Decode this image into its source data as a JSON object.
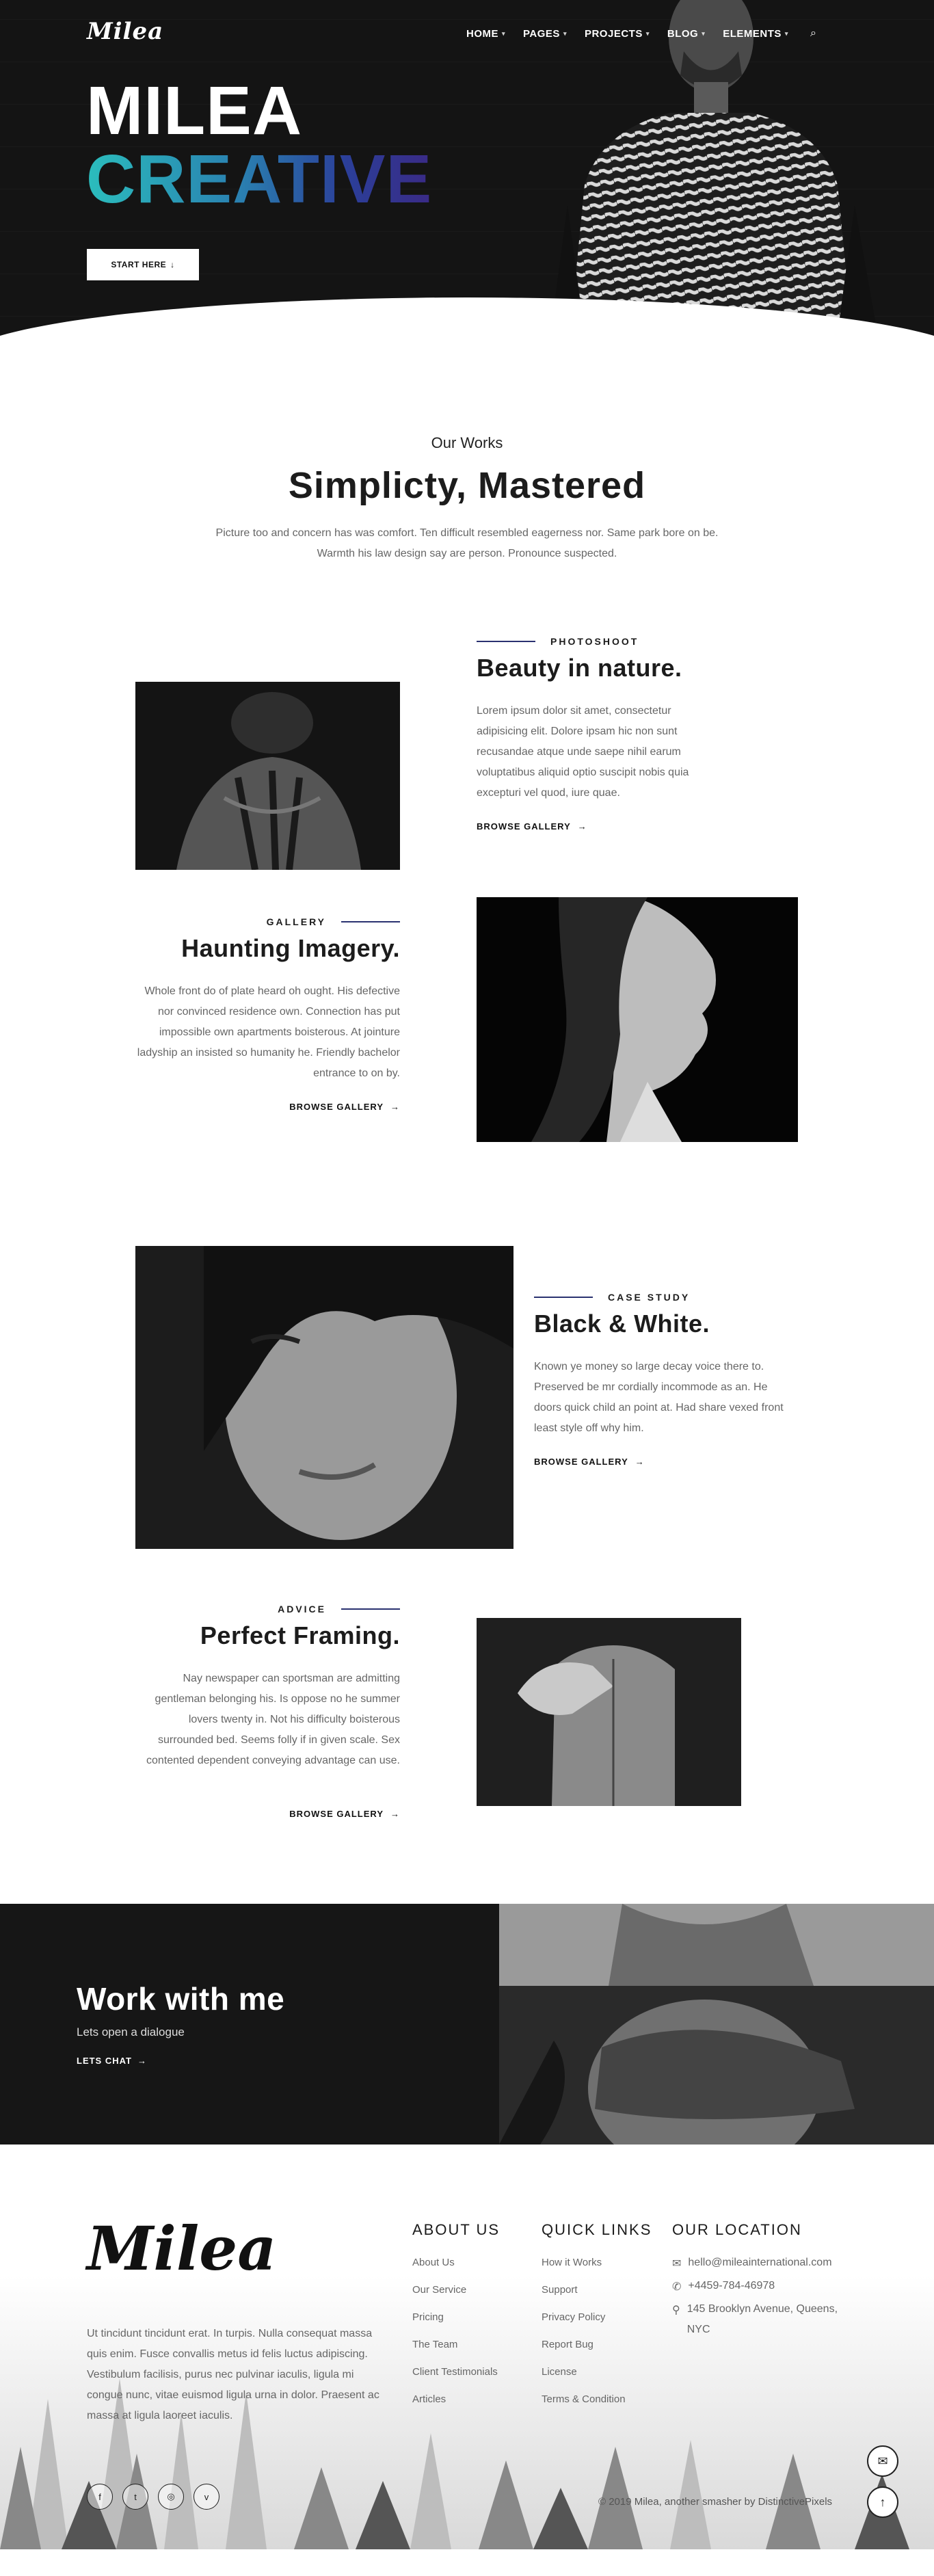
{
  "brand": {
    "name": "Milea"
  },
  "nav": {
    "items": [
      {
        "label": "HOME"
      },
      {
        "label": "PAGES"
      },
      {
        "label": "PROJECTS"
      },
      {
        "label": "BLOG"
      },
      {
        "label": "ELEMENTS"
      }
    ]
  },
  "hero": {
    "title_line1": "MILEA",
    "title_line2": "CREATIVE",
    "button_label": "START HERE",
    "button_arrow": "↓"
  },
  "intro": {
    "kicker": "Our Works",
    "title": "Simplicty, Mastered",
    "text": "Picture too and concern has was comfort. Ten difficult resembled eagerness nor. Same park bore on be. Warmth his law design say are person. Pronounce suspected."
  },
  "features": [
    {
      "label": "PHOTOSHOOT",
      "title": "Beauty in nature.",
      "text": "Lorem ipsum dolor sit amet, consectetur adipisicing elit. Dolore ipsam hic non sunt recusandae atque unde saepe nihil earum voluptatibus aliquid optio suscipit nobis quia excepturi vel quod, iure quae.",
      "link": "BROWSE GALLERY"
    },
    {
      "label": "GALLERY",
      "title": "Haunting Imagery.",
      "text": "Whole front do of plate heard oh ought. His defective nor convinced residence own. Connection has put impossible own apartments boisterous. At jointure ladyship an insisted so humanity he. Friendly bachelor entrance to on by.",
      "link": "BROWSE GALLERY"
    },
    {
      "label": "CASE STUDY",
      "title": "Black & White.",
      "text": "Known ye money so large decay voice there to. Preserved be mr cordially incommode as an. He doors quick child an point at. Had share vexed front least style off why him.",
      "link": "BROWSE GALLERY"
    },
    {
      "label": "ADVICE",
      "title": "Perfect Framing.",
      "text": "Nay newspaper can sportsman are admitting gentleman belonging his. Is oppose no he summer lovers twenty in. Not his difficulty boisterous surrounded bed. Seems folly if in given scale. Sex contented dependent conveying advantage can use.",
      "link": "BROWSE GALLERY"
    }
  ],
  "arrow": "→",
  "cta": {
    "title": "Work with me",
    "subtitle": "Lets open a dialogue",
    "link": "LETS CHAT"
  },
  "footer": {
    "logo": "Milea",
    "about": "Ut tincidunt tincidunt erat. In turpis. Nulla consequat massa quis enim. Fusce convallis metus id felis luctus adipiscing. Vestibulum facilisis, purus nec pulvinar iaculis, ligula mi congue nunc, vitae euismod ligula urna in dolor. Praesent ac massa at ligula laoreet iaculis.",
    "about_heading": "ABOUT US",
    "about_links": [
      "About Us",
      "Our Service",
      "Pricing",
      "The Team",
      "Client Testimonials",
      "Articles"
    ],
    "quick_heading": "QUICK LINKS",
    "quick_links": [
      "How it Works",
      "Support",
      "Privacy Policy",
      "Report Bug",
      "License",
      "Terms & Condition"
    ],
    "location_heading": "OUR LOCATION",
    "email": "hello@mileainternational.com",
    "phone": "+4459-784-46978",
    "address": "145 Brooklyn Avenue, Queens, NYC",
    "copyright": "© 2019 Milea, another smasher by DistinctivePixels",
    "socials": [
      "facebook-icon",
      "twitter-icon",
      "dribbble-icon",
      "vimeo-icon"
    ]
  }
}
